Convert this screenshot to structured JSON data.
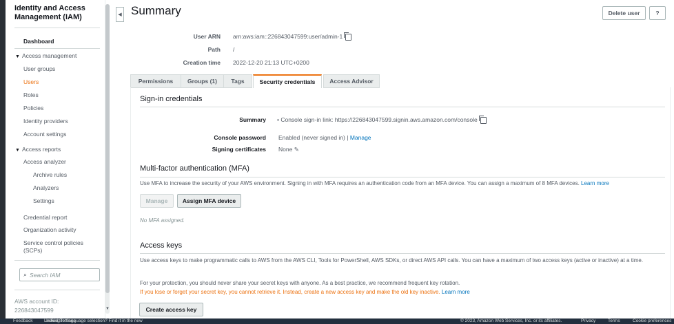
{
  "sidebar": {
    "title": "Identity and Access Management (IAM)",
    "dashboard": "Dashboard",
    "access_management": "Access management",
    "items_am": [
      "User groups",
      "Users",
      "Roles",
      "Policies",
      "Identity providers",
      "Account settings"
    ],
    "access_reports": "Access reports",
    "items_ar": [
      "Access analyzer",
      "Archive rules",
      "Analyzers",
      "Settings",
      "Credential report",
      "Organization activity",
      "Service control policies (SCPs)"
    ],
    "search_placeholder": "Search IAM",
    "account_label": "AWS account ID:",
    "account_id": "226843047599"
  },
  "header": {
    "title": "Summary",
    "delete_user": "Delete user",
    "help": "?"
  },
  "summary": {
    "user_arn_label": "User ARN",
    "user_arn": "arn:aws:iam::226843047599:user/admin-1",
    "path_label": "Path",
    "path": "/",
    "creation_label": "Creation time",
    "creation": "2022-12-20 21:13 UTC+0200"
  },
  "tabs": [
    "Permissions",
    "Groups (1)",
    "Tags",
    "Security credentials",
    "Access Advisor"
  ],
  "signin": {
    "title": "Sign-in credentials",
    "summary_label": "Summary",
    "summary_prefix": "Console sign-in link: ",
    "summary_link": "https://226843047599.signin.aws.amazon.com/console",
    "console_password_label": "Console password",
    "console_password": "Enabled (never signed in) |",
    "manage_link": "Manage",
    "signing_label": "Signing certificates",
    "signing": "None"
  },
  "mfa": {
    "title": "Multi-factor authentication (MFA)",
    "description": "Use MFA to increase the security of your AWS environment. Signing in with MFA requires an authentication code from an MFA device. You can assign a maximum of 8 MFA devices.",
    "learn_more": "Learn more",
    "manage_button": "Manage",
    "assign_button": "Assign MFA device",
    "empty": "No MFA assigned."
  },
  "access_keys": {
    "title": "Access keys",
    "description": "Use access keys to make programmatic calls to AWS from the AWS CLI, Tools for PowerShell, AWS SDKs, or direct AWS API calls. You can have a maximum of two access keys (active or inactive) at a time.",
    "protection": "For your protection, you should never share your secret keys with anyone. As a best practice, we recommend frequent key rotation.",
    "warning": "If you lose or forget your secret key, you cannot retrieve it. Instead, create a new access key and make the old key inactive.",
    "learn_more": "Learn more",
    "create_button": "Create access key"
  },
  "footer": {
    "feedback": "Feedback",
    "language_note": "Looking for language selection? Find it in the new",
    "unified_settings": "Unified Settings",
    "copyright": "© 2023, Amazon Web Services, Inc. or its affiliates.",
    "privacy": "Privacy",
    "terms": "Terms",
    "cookie": "Cookie preferences"
  },
  "colors": {
    "accent": "#ec7211",
    "link": "#0073bb",
    "footer_bg": "#232f3e"
  }
}
